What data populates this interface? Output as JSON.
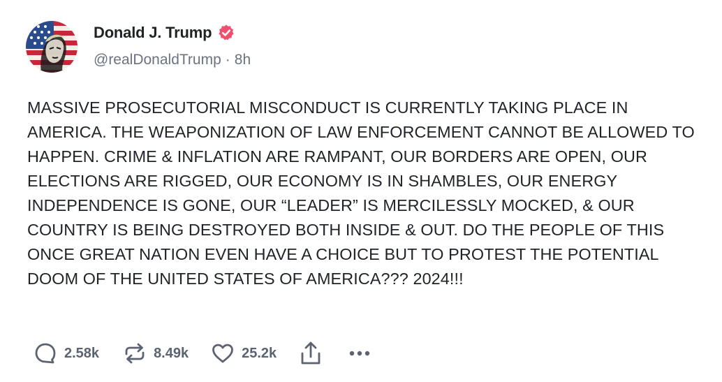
{
  "author": {
    "display_name": "Donald J. Trump",
    "handle": "@realDonaldTrump",
    "separator": "·",
    "timestamp": "8h",
    "verified": true
  },
  "post": {
    "text": "MASSIVE PROSECUTORIAL MISCONDUCT IS CURRENTLY TAKING PLACE IN AMERICA. THE WEAPONIZATION OF LAW ENFORCEMENT CANNOT BE ALLOWED TO HAPPEN. CRIME & INFLATION ARE RAMPANT, OUR BORDERS ARE OPEN, OUR ELECTIONS ARE RIGGED, OUR ECONOMY IS IN SHAMBLES, OUR ENERGY INDEPENDENCE IS GONE, OUR “LEADER” IS MERCILESSLY MOCKED, & OUR COUNTRY IS BEING DESTROYED BOTH INSIDE & OUT. DO THE PEOPLE OF THIS ONCE GREAT NATION EVEN HAVE A CHOICE BUT TO PROTEST THE POTENTIAL DOOM OF THE UNITED STATES OF AMERICA??? 2024!!!"
  },
  "actions": {
    "replies": "2.58k",
    "retruths": "8.49k",
    "likes": "25.2k"
  },
  "icons": {
    "avatar": "profile-avatar",
    "verified": "verified-badge-icon",
    "reply": "reply-bubble-icon",
    "retruth": "retruth-arrows-icon",
    "like": "heart-icon",
    "share": "share-upload-icon",
    "more": "more-ellipsis-icon"
  },
  "colors": {
    "verified_badge": "#f0506e",
    "text": "#1f2328",
    "muted": "#6b7280",
    "action": "#5c6370"
  }
}
